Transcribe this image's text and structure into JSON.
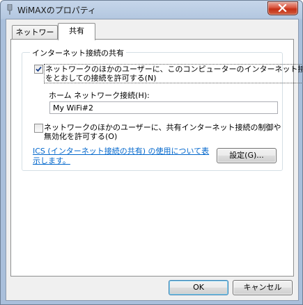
{
  "window": {
    "title": "WiMAXのプロパティ"
  },
  "tabs": [
    {
      "label": "ネットワーク",
      "active": false
    },
    {
      "label": "共有",
      "active": true
    }
  ],
  "sharing": {
    "group_title": "インターネット接続の共有",
    "allow_connect": {
      "line1": "ネットワークのほかのユーザーに、このコンピューターのインターネット接続",
      "line2": "をとおしての接続を許可する(N)",
      "checked": true
    },
    "home_network_label": "ホーム ネットワーク接続(H):",
    "home_network_value": "My WiFi#2",
    "allow_control": {
      "line1": "ネットワークのほかのユーザーに、共有インターネット接続の制御や",
      "line2": "無効化を許可する(O)",
      "checked": false
    },
    "help_link": {
      "line1": "ICS (インターネット接続の共有) の使用について表",
      "line2": "示します。"
    },
    "settings_button": "設定(G)..."
  },
  "buttons": {
    "ok": "OK",
    "cancel": "キャンセル"
  },
  "colors": {
    "link": "#0066cc",
    "close_button": "#c43016"
  }
}
